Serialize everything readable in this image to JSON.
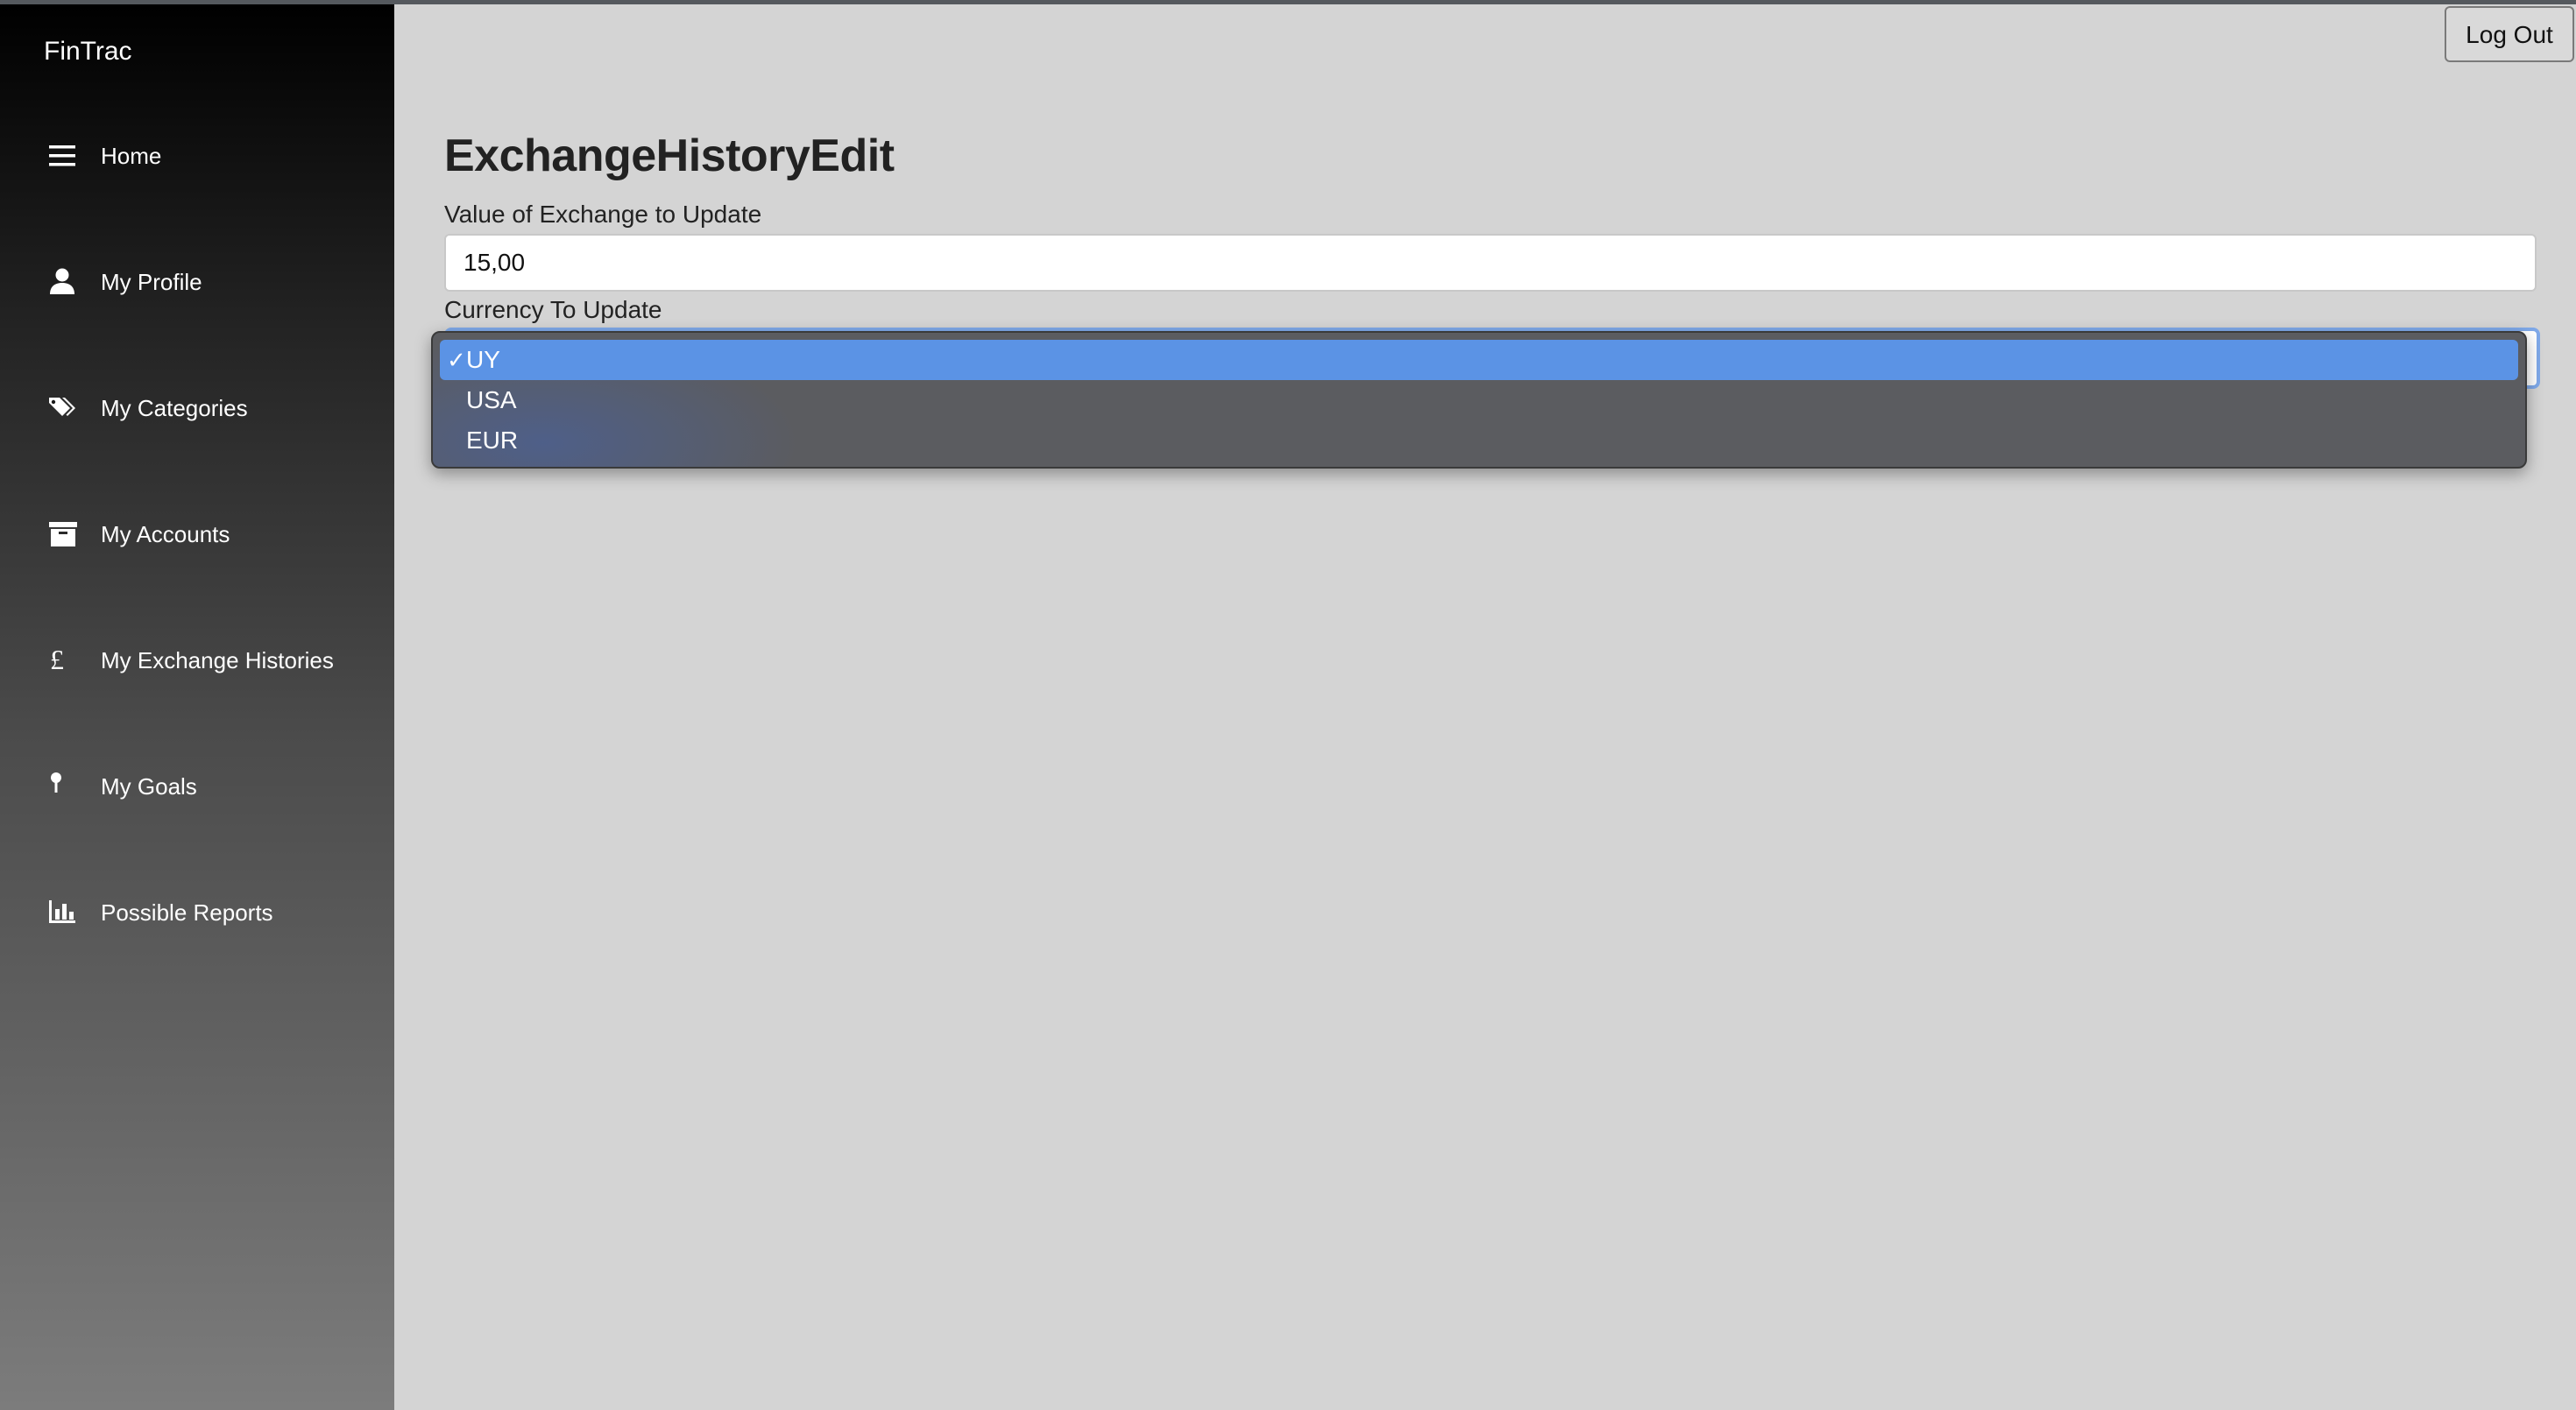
{
  "app": {
    "brand": "FinTrac"
  },
  "sidebar": {
    "items": [
      {
        "label": "Home",
        "icon": "hamburger-icon"
      },
      {
        "label": "My Profile",
        "icon": "user-icon"
      },
      {
        "label": "My Categories",
        "icon": "tags-icon"
      },
      {
        "label": "My Accounts",
        "icon": "archive-icon"
      },
      {
        "label": "My Exchange Histories",
        "icon": "pound-icon"
      },
      {
        "label": "My Goals",
        "icon": "pin-icon"
      },
      {
        "label": "Possible Reports",
        "icon": "bar-chart-icon"
      }
    ]
  },
  "header": {
    "logout_label": "Log Out"
  },
  "form": {
    "title": "ExchangeHistoryEdit",
    "value_label": "Value of Exchange to Update",
    "value": "15,00",
    "currency_label": "Currency To Update",
    "currency_selected": "UY",
    "currency_options": [
      {
        "label": "UY",
        "selected": true
      },
      {
        "label": "USA",
        "selected": false
      },
      {
        "label": "EUR",
        "selected": false
      }
    ],
    "check_mark": "✓"
  },
  "colors": {
    "selection": "#5b93e5",
    "dropdown_bg": "#5b5c60",
    "main_bg": "#d4d4d4"
  }
}
